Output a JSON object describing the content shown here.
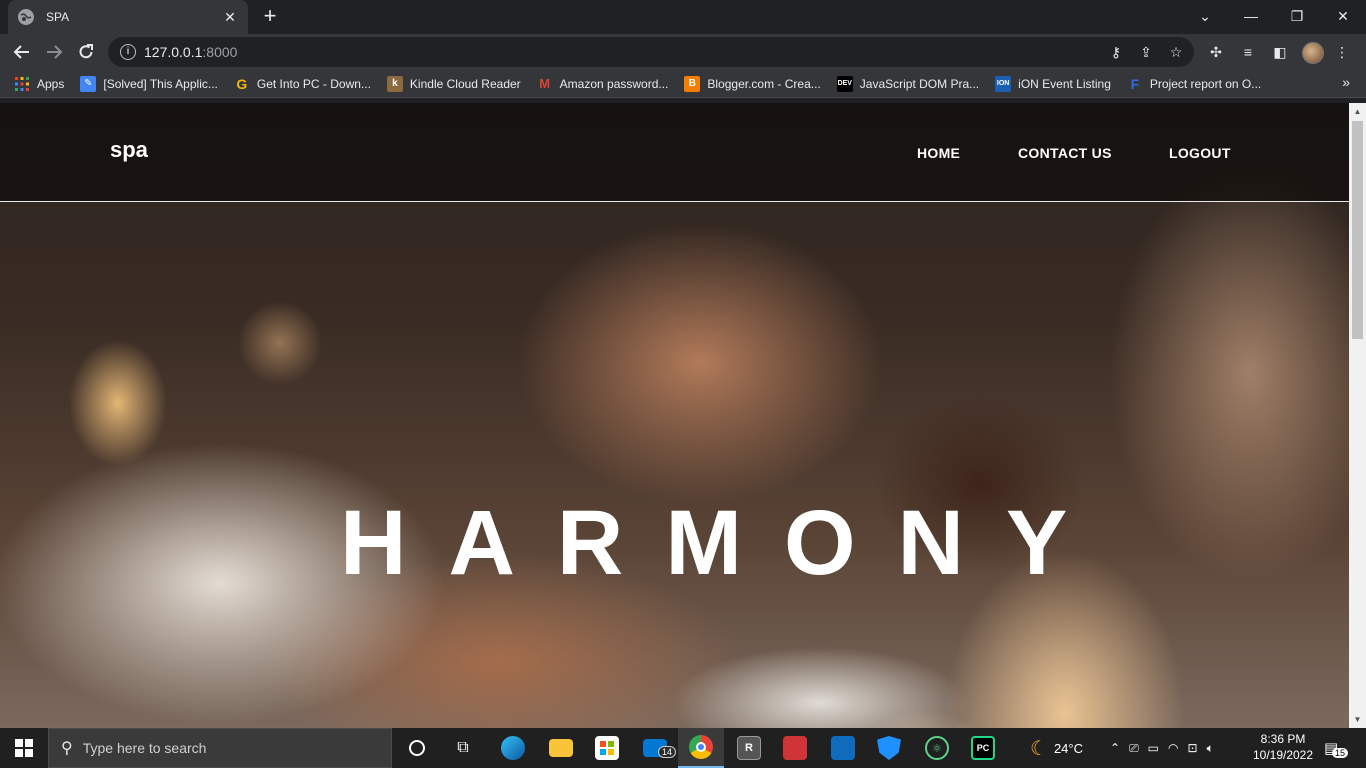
{
  "browser": {
    "tab_title": "SPA",
    "tab_close": "✕",
    "new_tab": "+",
    "url_host": "127.0.0.1",
    "url_port": ":8000",
    "window_controls": [
      "⌄",
      "—",
      "❐",
      "✕"
    ]
  },
  "bookmarks": [
    {
      "label": "Apps",
      "icon": "apps-grid-icon",
      "color": "#ea4335"
    },
    {
      "label": "[Solved] This Applic...",
      "icon": "solved-icon",
      "color": "#4285f4"
    },
    {
      "label": "Get Into PC - Down...",
      "icon": "g-icon",
      "color": "#f4b400"
    },
    {
      "label": "Kindle Cloud Reader",
      "icon": "kindle-icon",
      "color": "#8b6b3d"
    },
    {
      "label": "Amazon password...",
      "icon": "gmail-icon",
      "color": "#db4437"
    },
    {
      "label": "Blogger.com - Crea...",
      "icon": "blogger-icon",
      "color": "#f57d00"
    },
    {
      "label": "JavaScript DOM Pra...",
      "icon": "dev-icon",
      "color": "#000000"
    },
    {
      "label": "iON Event Listing",
      "icon": "ion-icon",
      "color": "#1a5fb4"
    },
    {
      "label": "Project report on O...",
      "icon": "project-icon",
      "color": "#2b6cd6"
    }
  ],
  "page": {
    "brand": "spa",
    "nav": [
      "HOME",
      "CONTACT US",
      "LOGOUT"
    ],
    "hero_text": "HARMONY"
  },
  "taskbar": {
    "search_placeholder": "Type here to search",
    "mail_badge": "14",
    "weather": "24°C",
    "time": "8:36 PM",
    "date": "10/19/2022",
    "notifications": "15"
  }
}
